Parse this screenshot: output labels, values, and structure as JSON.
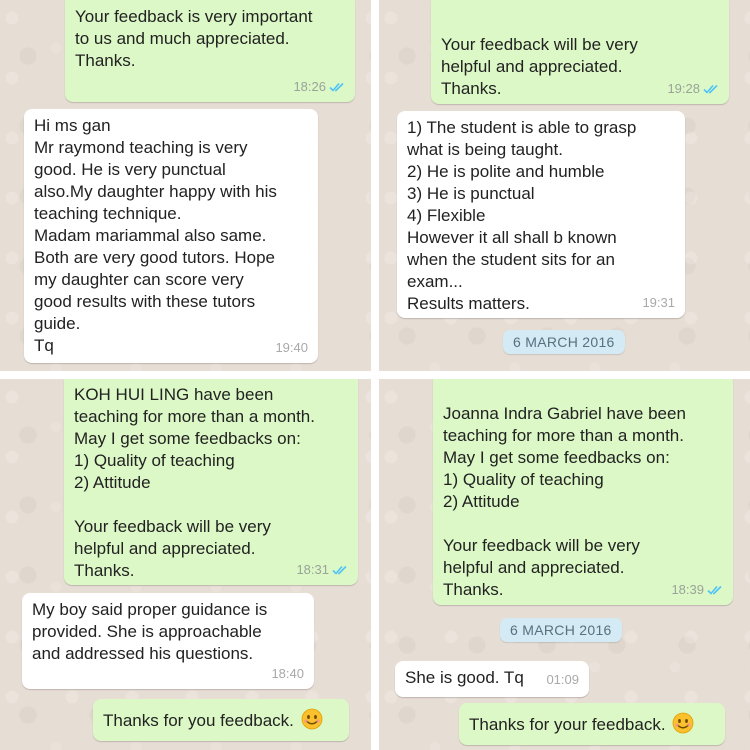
{
  "panel1": {
    "out_message": "Your feedback is very important\nto us and much appreciated.\nThanks.",
    "out_time": "18:26",
    "in_message": "Hi ms gan\nMr raymond teaching is very\ngood. He is very punctual\nalso.My daughter happy with his\nteaching technique.\nMadam mariammal also same.\nBoth are very good tutors. Hope\nmy daughter can score very\ngood results with these tutors\nguide.\nTq",
    "in_time": "19:40"
  },
  "panel2": {
    "out_message": "Your feedback will be very\nhelpful and appreciated.\nThanks.",
    "out_time": "19:28",
    "in_message": "1) The student is able to grasp\nwhat is being taught.\n2) He is polite and humble\n3) He is punctual\n4) Flexible\nHowever it all shall b known\nwhen the student sits for an\nexam...\nResults matters.",
    "in_time": "19:31",
    "date_chip": "6 MARCH 2016"
  },
  "panel3": {
    "out_message": "KOH HUI LING have been\nteaching for more than a month.\nMay I get some feedbacks on:\n1) Quality of teaching\n2) Attitude\n\nYour feedback will be very\nhelpful and appreciated.\nThanks.",
    "out_time": "18:31",
    "in_message": "My boy said proper guidance is\nprovided. She is approachable\nand addressed his questions.",
    "in_time": "18:40",
    "reply": "Thanks for you feedback."
  },
  "panel4": {
    "out_message": "Joanna Indra Gabriel have been\nteaching for more than a month.\nMay I get some feedbacks on:\n1) Quality of teaching\n2) Attitude\n\nYour feedback will be very\nhelpful and appreciated.\nThanks.",
    "out_time": "18:39",
    "date_chip": "6 MARCH 2016",
    "in_message": "She is good. Tq",
    "in_time": "01:09",
    "reply": "Thanks for your feedback."
  },
  "icons": {
    "read_receipt": "double-check-icon",
    "emoji": "smiling-face-emoji-icon"
  },
  "colors": {
    "outgoing_bubble": "#dcf8c6",
    "incoming_bubble": "#ffffff",
    "read_tick": "#4fc3f7",
    "date_chip": "#d4eaf4"
  }
}
